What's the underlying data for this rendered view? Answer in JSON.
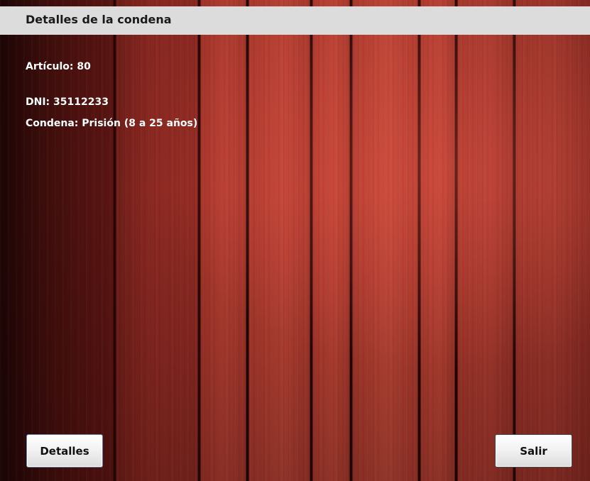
{
  "window": {
    "title": "Detalles de la condena"
  },
  "details": {
    "articulo": "Artículo: 80",
    "dni": "DNI: 35112233",
    "condena": "Condena: Prisión (8 a 25 años)"
  },
  "buttons": {
    "detalles_label": "Detalles",
    "salir_label": "Salir"
  },
  "colors": {
    "title_bar": "#dcdcdc",
    "background_wood": "#a9352b",
    "text_primary": "#ffffff"
  }
}
